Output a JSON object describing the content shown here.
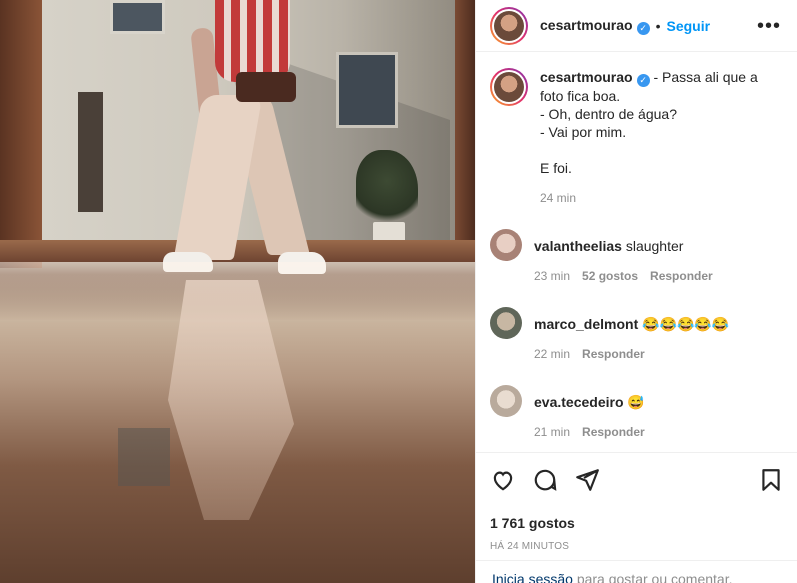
{
  "post": {
    "username": "cesartmourao",
    "follow_label": "Seguir",
    "dot": "•",
    "more": "•••",
    "verified_mark": "✓",
    "caption": "- Passa ali que a foto fica boa.\n- Oh, dentro de água?\n- Vai por mim.\n\nE foi.",
    "caption_time": "24 min"
  },
  "comments": [
    {
      "user": "valantheelias",
      "text": "slaughter",
      "time": "23 min",
      "likes": "52 gostos",
      "reply": "Responder",
      "avatar_color": "#c9a9a0"
    },
    {
      "user": "marco_delmont",
      "text": "😂😂😂😂😂",
      "time": "22 min",
      "likes": "",
      "reply": "Responder",
      "avatar_color": "#8a8f83"
    },
    {
      "user": "eva.tecedeiro",
      "text": "😅",
      "time": "21 min",
      "likes": "",
      "reply": "Responder",
      "avatar_color": "#d9d1c7"
    }
  ],
  "actions": {
    "likes": "1 761 gostos",
    "time": "HÁ 24 MINUTOS"
  },
  "login": {
    "link": "Inicia sessão",
    "text": " para gostar ou comentar."
  },
  "icons": [
    "heart-icon",
    "comment-icon",
    "share-icon",
    "save-icon",
    "more-icon",
    "verified-icon"
  ],
  "colors": {
    "accent": "#0095f6",
    "verified": "#3897f0",
    "muted": "#8e8e8e",
    "text": "#262626"
  }
}
